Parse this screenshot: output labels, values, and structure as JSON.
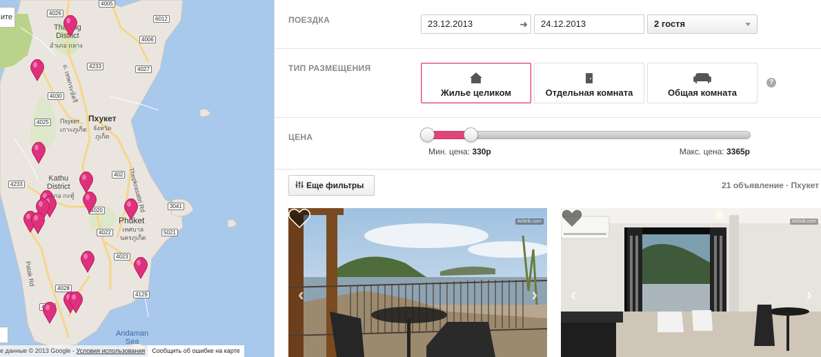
{
  "map": {
    "labels": {
      "thalang_district": "Thalang\nDistrict",
      "thalang_thai": "อำเภอ ถลาง",
      "phuket_cyr": "Пхукет",
      "phuket_small": "Пхукет",
      "phuket_thai": "เกาะภูเก็ต",
      "changwat_thai": "จังหวัด\nภูเก็ต",
      "kathu_district": "Kathu\nDistrict",
      "kathu_thai": "อำเภอ กะทู้",
      "phuket_town": "Phuket",
      "phuket_town_thai": "เทศบาล\nนครภูเก็ต",
      "andaman_sea": "Andaman\nSea",
      "thepkrasattri_rd": "Thepkrasattri Rd",
      "patak_rd": "Patak Rd",
      "thepkrasattri_rd_2": "ถ. เทพกระษัตรี"
    },
    "roads": [
      "4026",
      "4005",
      "4006",
      "6012",
      "4233",
      "4027",
      "4030",
      "4025",
      "4233",
      "402",
      "4020",
      "4022",
      "3041",
      "5021",
      "4023",
      "4028",
      "4129",
      "4024"
    ],
    "side_button": "ите",
    "attribution": "е данные © 2013 Google -",
    "terms_link": "Условия использования",
    "report_link": "Сообщить об ошибке на карте",
    "pin_color": "#e0307d"
  },
  "trip": {
    "label": "ПОЕЗДКА",
    "checkin": "23.12.2013",
    "checkout": "24.12.2013",
    "arrow": "➜",
    "guests": "2 гостя"
  },
  "room_type": {
    "label": "ТИП РАЗМЕЩЕНИЯ",
    "options": [
      {
        "label": "Жилье целиком",
        "icon": "house-icon",
        "active": true
      },
      {
        "label": "Отдельная комната",
        "icon": "door-icon",
        "active": false
      },
      {
        "label": "Общая комната",
        "icon": "couch-icon",
        "active": false
      }
    ],
    "help": "?"
  },
  "price": {
    "label": "ЦЕНА",
    "min_label": "Мин. цена:",
    "min_value": "330р",
    "max_label": "Макс. цена:",
    "max_value": "3365р",
    "selected_fraction_start": 0.0,
    "selected_fraction_end": 0.09
  },
  "filters": {
    "more_filters": "Еще фильтры",
    "results": "21 объявление · Пхукет"
  },
  "listings": [
    {
      "watermark": "Airbnb.com",
      "prev": "‹",
      "next": "›"
    },
    {
      "watermark": "Airbnb.com",
      "prev": "‹",
      "next": "›"
    }
  ],
  "colors": {
    "accent": "#e0457a",
    "label_gray": "#888888"
  }
}
